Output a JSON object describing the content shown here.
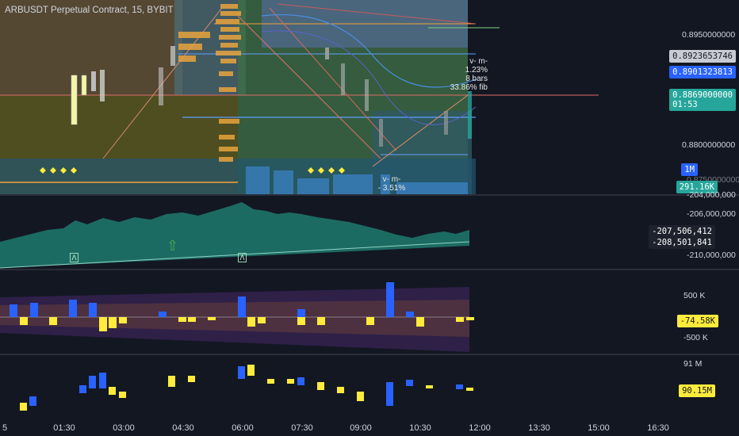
{
  "header": {
    "title": "ARBUSDT Perpetual Contract, 15, BYBIT"
  },
  "price_axis": {
    "labels": [
      "0.8950000000",
      "0.8800000000",
      "0.8750000000"
    ],
    "tags": {
      "tag1": {
        "text": "0.8923653746",
        "bg": "#c8cbd2",
        "fg": "#131722"
      },
      "tag2": {
        "text": "0.8901323813",
        "bg": "#2962ff",
        "fg": "#ffffff"
      },
      "tag3": {
        "text": "0.8869000000",
        "sub": "01:53",
        "bg": "#26a69a",
        "fg": "#ffffff"
      },
      "vol_scale": {
        "text": "1M",
        "bg": "#2962ff",
        "fg": "#ffffff"
      },
      "vol": {
        "text": "291.16K",
        "bg": "#26a69a",
        "fg": "#ffffff"
      }
    }
  },
  "annotations": {
    "upper": [
      "v- m-",
      "1.23%",
      "8 bars",
      "33.86% fib"
    ],
    "lower": [
      "v- m-",
      "- 3.51%"
    ]
  },
  "pane2": {
    "labels": [
      "-204,000,000",
      "-206,000,000",
      "-210,000,000"
    ],
    "tag_a": "-207,506,412",
    "tag_b": "-208,501,841"
  },
  "pane3": {
    "labels": [
      "500 K",
      "-500 K"
    ],
    "tag": "-74.58K"
  },
  "pane4": {
    "labels": [
      "91 M"
    ],
    "tag": "90.15M"
  },
  "time_axis": [
    "5",
    "01:30",
    "03:00",
    "04:30",
    "06:00",
    "07:30",
    "09:00",
    "10:30",
    "12:00",
    "13:30",
    "15:00",
    "16:30"
  ],
  "colors": {
    "up": "#2962ff",
    "down": "#ffeb3b",
    "teal": "#1f7a6e",
    "bg": "#131722"
  }
}
